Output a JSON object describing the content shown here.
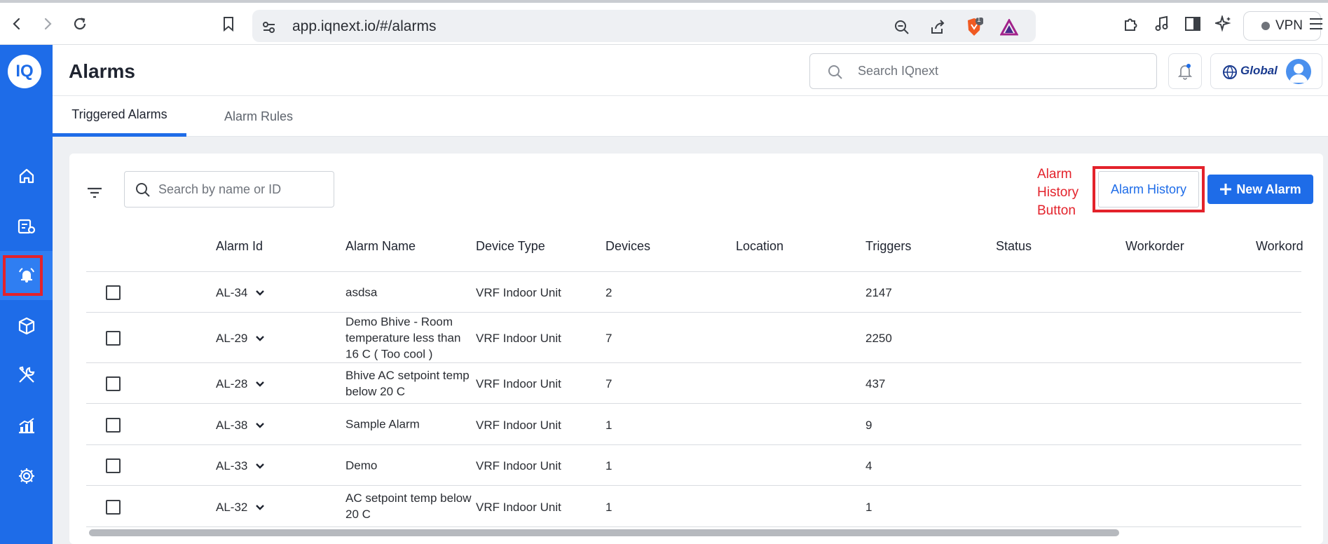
{
  "browser": {
    "url": "app.iqnext.io/#/alarms",
    "brave_badge": "1",
    "vpn_label": "VPN"
  },
  "sidebar": {
    "logo_text": "IQ",
    "items": [
      {
        "icon": "home-icon"
      },
      {
        "icon": "device-settings-icon"
      },
      {
        "icon": "alarm-icon",
        "active": true
      },
      {
        "icon": "cube-icon"
      },
      {
        "icon": "tools-icon"
      },
      {
        "icon": "analytics-icon"
      },
      {
        "icon": "gear-icon"
      }
    ]
  },
  "header": {
    "title": "Alarms",
    "search_placeholder": "Search IQnext",
    "org_name": "Global"
  },
  "tabs": [
    {
      "label": "Triggered Alarms",
      "active": true
    },
    {
      "label": "Alarm Rules",
      "active": false
    }
  ],
  "toolbar": {
    "search_placeholder": "Search by name or ID",
    "annotation": "Alarm History Button",
    "history_label": "Alarm History",
    "new_label": "New Alarm"
  },
  "table": {
    "columns": [
      "Alarm Id",
      "Alarm Name",
      "Device Type",
      "Devices",
      "Location",
      "Triggers",
      "Status",
      "Workorder",
      "Workord"
    ],
    "rows": [
      {
        "id": "AL-34",
        "name": "asdsa",
        "device_type": "VRF Indoor Unit",
        "devices": "2",
        "location": "",
        "triggers": "2147"
      },
      {
        "id": "AL-29",
        "name": "Demo Bhive - Room temperature less than 16 C ( Too cool )",
        "device_type": "VRF Indoor Unit",
        "devices": "7",
        "location": "",
        "triggers": "2250"
      },
      {
        "id": "AL-28",
        "name": "Bhive AC setpoint temp below 20 C",
        "device_type": "VRF Indoor Unit",
        "devices": "7",
        "location": "",
        "triggers": "437"
      },
      {
        "id": "AL-38",
        "name": "Sample Alarm",
        "device_type": "VRF Indoor Unit",
        "devices": "1",
        "location": "",
        "triggers": "9"
      },
      {
        "id": "AL-33",
        "name": "Demo",
        "device_type": "VRF Indoor Unit",
        "devices": "1",
        "location": "",
        "triggers": "4"
      },
      {
        "id": "AL-32",
        "name": "AC setpoint temp below 20 C",
        "device_type": "VRF Indoor Unit",
        "devices": "1",
        "location": "",
        "triggers": "1"
      }
    ]
  },
  "colors": {
    "brand_blue": "#1e6ce8",
    "annotation_red": "#e3222b"
  }
}
